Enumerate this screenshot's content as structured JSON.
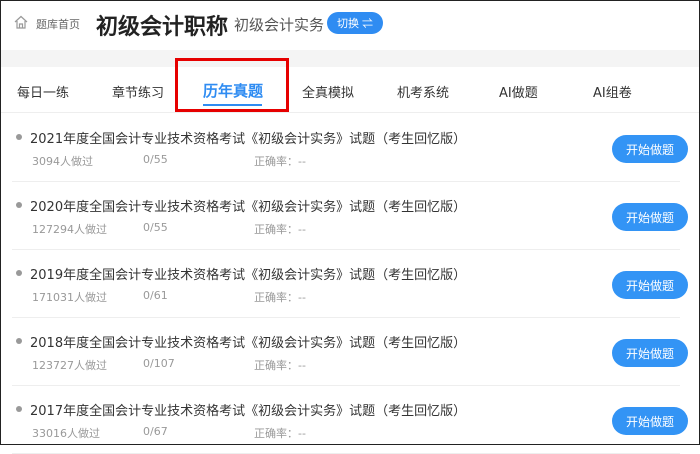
{
  "header": {
    "breadcrumb": "题库首页",
    "title": "初级会计职称",
    "subject": "初级会计实务",
    "switch_label": "切换 ⇌"
  },
  "tabs": [
    "每日一练",
    "章节练习",
    "历年真题",
    "全真模拟",
    "机考系统",
    "AI做题",
    "AI组卷"
  ],
  "active_tab": "历年真题",
  "rows": [
    {
      "title": "2021年度全国会计专业技术资格考试《初级会计实务》试题（考生回忆版）",
      "done": "3094人做过",
      "progress": "0/55",
      "accuracy": "正确率：--",
      "button": "开始做题"
    },
    {
      "title": "2020年度全国会计专业技术资格考试《初级会计实务》试题（考生回忆版）",
      "done": "127294人做过",
      "progress": "0/55",
      "accuracy": "正确率：--",
      "button": "开始做题"
    },
    {
      "title": "2019年度全国会计专业技术资格考试《初级会计实务》试题（考生回忆版）",
      "done": "171031人做过",
      "progress": "0/61",
      "accuracy": "正确率：--",
      "button": "开始做题"
    },
    {
      "title": "2018年度全国会计专业技术资格考试《初级会计实务》试题（考生回忆版）",
      "done": "123727人做过",
      "progress": "0/107",
      "accuracy": "正确率：--",
      "button": "开始做题"
    },
    {
      "title": "2017年度全国会计专业技术资格考试《初级会计实务》试题（考生回忆版）",
      "done": "33016人做过",
      "progress": "0/67",
      "accuracy": "正确率：--",
      "button": "开始做题"
    }
  ],
  "colors": {
    "accent": "#2f8cf2",
    "highlight": "#e60000"
  }
}
